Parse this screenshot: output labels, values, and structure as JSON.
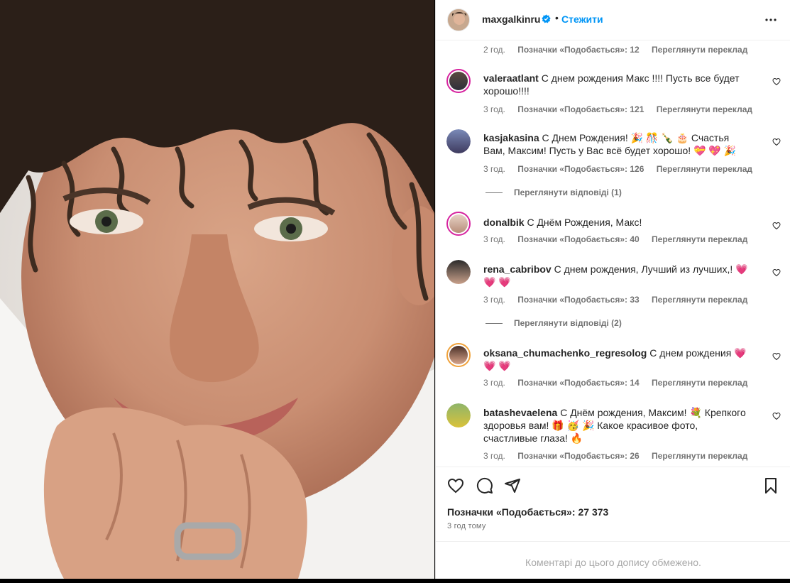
{
  "post": {
    "username": "maxgalkinru",
    "dot": "•",
    "follow_label": "Стежити",
    "likes_label": "Позначки «Подобається»: 27 373",
    "time_label": "3 год тому",
    "restricted_label": "Коментарі до цього допису обмежено."
  },
  "first_meta": {
    "time": "2 год.",
    "likes": "Позначки «Подобається»: 12",
    "translate": "Переглянути переклад"
  },
  "comments": [
    {
      "user": "valeraatlant",
      "text": "С днем рождения Макс !!!! Пусть все будет хорошо!!!!",
      "time": "3 год.",
      "likes": "Позначки «Подобається»: 121",
      "translate": "Переглянути переклад"
    },
    {
      "user": "kasjakasina",
      "text": "С Днем Рождения! 🎉 🎊 🍾 🎂 Счастья Вам, Максим! Пусть у Вас всё будет хорошо! 💝 💖 🎉",
      "time": "3 год.",
      "likes": "Позначки «Подобається»: 126",
      "translate": "Переглянути переклад",
      "replies": "Переглянути відповіді (1)"
    },
    {
      "user": "donalbik",
      "text": "С Днём Рождения, Макс!",
      "time": "3 год.",
      "likes": "Позначки «Подобається»: 40",
      "translate": "Переглянути переклад"
    },
    {
      "user": "rena_cabribov",
      "text": "С днем рождения, Лучший из лучших,! 💗 💗 💗",
      "time": "3 год.",
      "likes": "Позначки «Подобається»: 33",
      "translate": "Переглянути переклад",
      "replies": "Переглянути відповіді (2)"
    },
    {
      "user": "oksana_chumachenko_regresolog",
      "text": "С днем рождения 💗 💗 💗",
      "time": "3 год.",
      "likes": "Позначки «Подобається»: 14",
      "translate": "Переглянути переклад"
    },
    {
      "user": "batashevaelena",
      "text": "С Днём рождения, Максим! 💐 Крепкого здоровья вам! 🎁 🥳 🎉 Какое красивое фото, счастливые глаза! 🔥",
      "time": "3 год.",
      "likes": "Позначки «Подобається»: 26",
      "translate": "Переглянути переклад"
    }
  ],
  "icons": {
    "like": "heart-icon",
    "comment": "comment-icon",
    "share": "share-icon",
    "save": "bookmark-icon",
    "more": "more-icon",
    "verified": "verified-badge-icon"
  },
  "colors": {
    "accent": "#0095f6",
    "verified": "#0095f6",
    "muted": "#737373"
  }
}
